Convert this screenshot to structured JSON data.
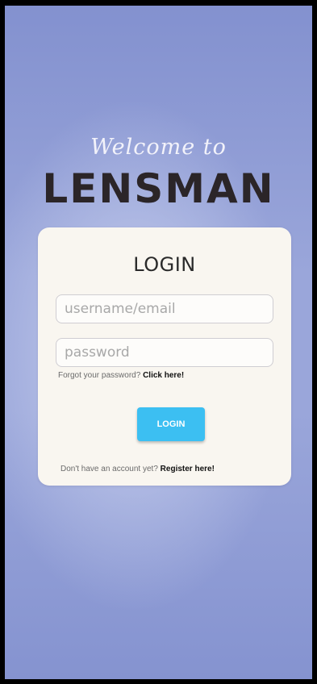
{
  "welcome_text": "Welcome to",
  "brand_name": "LENSMAN",
  "login_card": {
    "title": "LOGIN",
    "username_placeholder": "username/email",
    "password_placeholder": "password",
    "forgot_prefix": "Forgot your password? ",
    "forgot_link": "Click here!",
    "login_button": "LOGIN",
    "register_prefix": "Don't have an account yet? ",
    "register_link": "Register here!"
  },
  "colors": {
    "background": "#9aa6da",
    "card": "#f9f6f0",
    "button": "#3cbff2",
    "brand_text": "#2b2528"
  }
}
